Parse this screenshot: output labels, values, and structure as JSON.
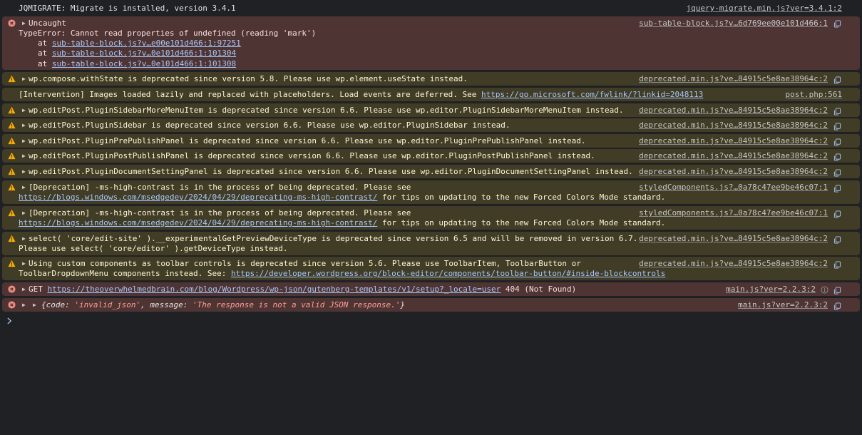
{
  "messages": [
    {
      "level": "info",
      "text": "JQMIGRATE: Migrate is installed, version 3.4.1",
      "source": "jquery-migrate.min.js?ver=3.4.1:2"
    },
    {
      "level": "error",
      "title": "Uncaught",
      "text": "TypeError: Cannot read properties of undefined (reading 'mark')",
      "source": "sub-table-block.js?v…6d769ee00e101d466:1",
      "stack": [
        {
          "prefix": "at ",
          "link": "sub-table-block.js?v…e00e101d466:1:97251"
        },
        {
          "prefix": "at ",
          "link": "sub-table-block.js?v…0e101d466:1:101304"
        },
        {
          "prefix": "at ",
          "link": "sub-table-block.js?v…0e101d466:1:101308"
        }
      ]
    },
    {
      "level": "warn",
      "text": "wp.compose.withState is deprecated since version 5.8. Please use wp.element.useState instead.",
      "source": "deprecated.min.js?ve…84915c5e8ae38964c:2"
    },
    {
      "level": "violation",
      "text": "[Intervention] Images loaded lazily and replaced with placeholders. Load events are deferred. See ",
      "link": "https://go.microsoft.com/fwlink/?linkid=2048113",
      "source": "post.php:561"
    },
    {
      "level": "warn",
      "text": "wp.editPost.PluginSidebarMoreMenuItem is deprecated since version 6.6. Please use wp.editor.PluginSidebarMoreMenuItem instead.",
      "source": "deprecated.min.js?ve…84915c5e8ae38964c:2"
    },
    {
      "level": "warn",
      "text": "wp.editPost.PluginSidebar is deprecated since version 6.6. Please use wp.editor.PluginSidebar instead.",
      "source": "deprecated.min.js?ve…84915c5e8ae38964c:2"
    },
    {
      "level": "warn",
      "text": "wp.editPost.PluginPrePublishPanel is deprecated since version 6.6. Please use wp.editor.PluginPrePublishPanel instead.",
      "source": "deprecated.min.js?ve…84915c5e8ae38964c:2"
    },
    {
      "level": "warn",
      "text": "wp.editPost.PluginPostPublishPanel is deprecated since version 6.6. Please use wp.editor.PluginPostPublishPanel instead.",
      "source": "deprecated.min.js?ve…84915c5e8ae38964c:2"
    },
    {
      "level": "warn",
      "text": "wp.editPost.PluginDocumentSettingPanel is deprecated since version 6.6. Please use wp.editor.PluginDocumentSettingPanel instead.",
      "source": "deprecated.min.js?ve…84915c5e8ae38964c:2"
    },
    {
      "level": "warn",
      "text": "[Deprecation] -ms-high-contrast is in the process of being deprecated. Please see",
      "link": "https://blogs.windows.com/msedgedev/2024/04/29/deprecating-ms-high-contrast/",
      "after": " for tips on updating to the new Forced Colors Mode standard.",
      "source": "styledComponents.js?…0a78c47ee9be46c07:1"
    },
    {
      "level": "warn",
      "text": "[Deprecation] -ms-high-contrast is in the process of being deprecated. Please see",
      "link": "https://blogs.windows.com/msedgedev/2024/04/29/deprecating-ms-high-contrast/",
      "after": " for tips on updating to the new Forced Colors Mode standard.",
      "source": "styledComponents.js?…0a78c47ee9be46c07:1"
    },
    {
      "level": "warn",
      "text": "select( 'core/edit-site' ).__experimentalGetPreviewDeviceType is deprecated since version 6.5 and will be removed in version 6.7.",
      "text2": "Please use select( 'core/editor' ).getDeviceType instead.",
      "source": "deprecated.min.js?ve…84915c5e8ae38964c:2"
    },
    {
      "level": "warn",
      "text": "Using custom components as toolbar controls is deprecated since version 5.6. Please use ToolbarItem, ToolbarButton or",
      "text2": "ToolbarDropdownMenu components instead. See: ",
      "link": "https://developer.wordpress.org/block-editor/components/toolbar-button/#inside-blockcontrols",
      "source": "deprecated.min.js?ve…84915c5e8ae38964c:2"
    },
    {
      "level": "error",
      "method": "GET",
      "link": "https://theoverwhelmedbrain.com/blog/Wordpress/wp-json/gutenberg-templates/v1/setup?_locale=user",
      "status": "404 (Not Found)",
      "source": "main.js?ver=2.2.3:2"
    },
    {
      "level": "error",
      "obj_open": "{",
      "key1": "code",
      "val1": "'invalid_json'",
      "key2": "message",
      "val2": "'The response is not a valid JSON response.'",
      "obj_close": "}",
      "source": "main.js?ver=2.2.3:2"
    }
  ],
  "colors": {
    "background": "#202124",
    "error_bg": "#4e3534",
    "warn_bg": "#413c26",
    "link": "#a8c7fa",
    "warn_icon": "#f9ab00",
    "error_icon": "#f28b82"
  },
  "icons": {
    "error": "error-circle-icon",
    "warn": "warning-triangle-icon",
    "copy": "copy-icon",
    "prompt": "chevron-right-icon"
  }
}
